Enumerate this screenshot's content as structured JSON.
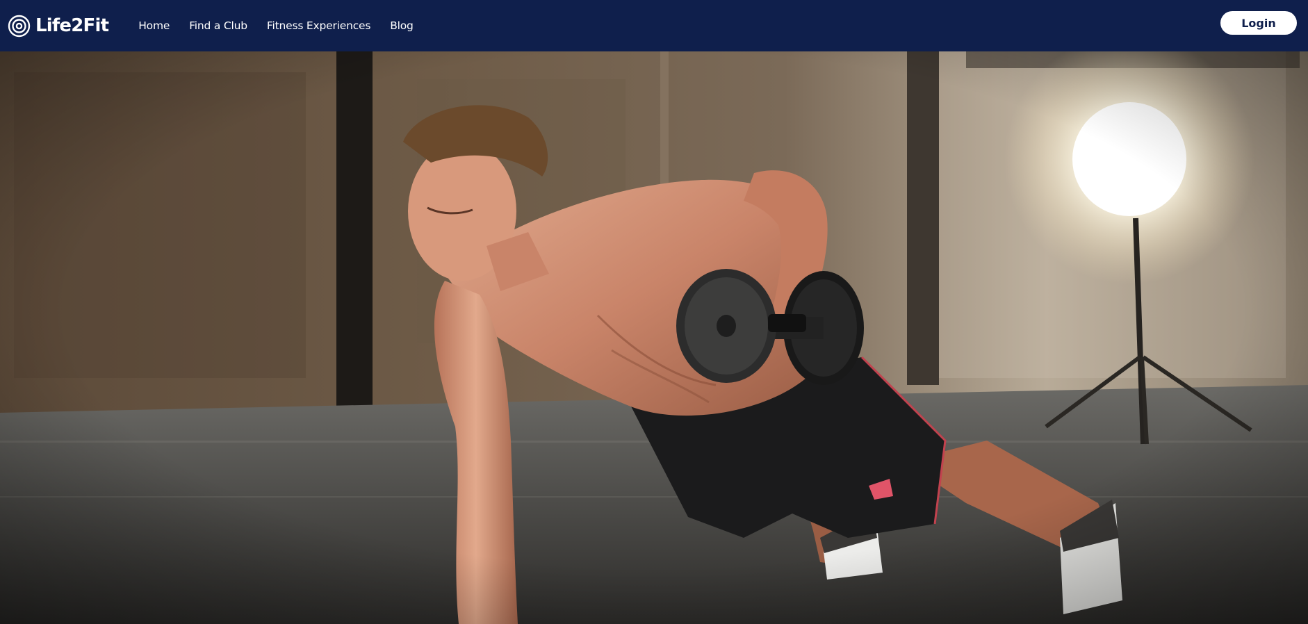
{
  "brand": {
    "name": "Life2Fit",
    "icon": "concentric-circles-logo-icon",
    "color": "#0f1f4c"
  },
  "nav": {
    "links": [
      {
        "label": "Home"
      },
      {
        "label": "Find a Club"
      },
      {
        "label": "Fitness Experiences"
      },
      {
        "label": "Blog"
      }
    ],
    "login_label": "Login"
  },
  "hero": {
    "image": "fitness-man-dumbbell-row-photo"
  }
}
